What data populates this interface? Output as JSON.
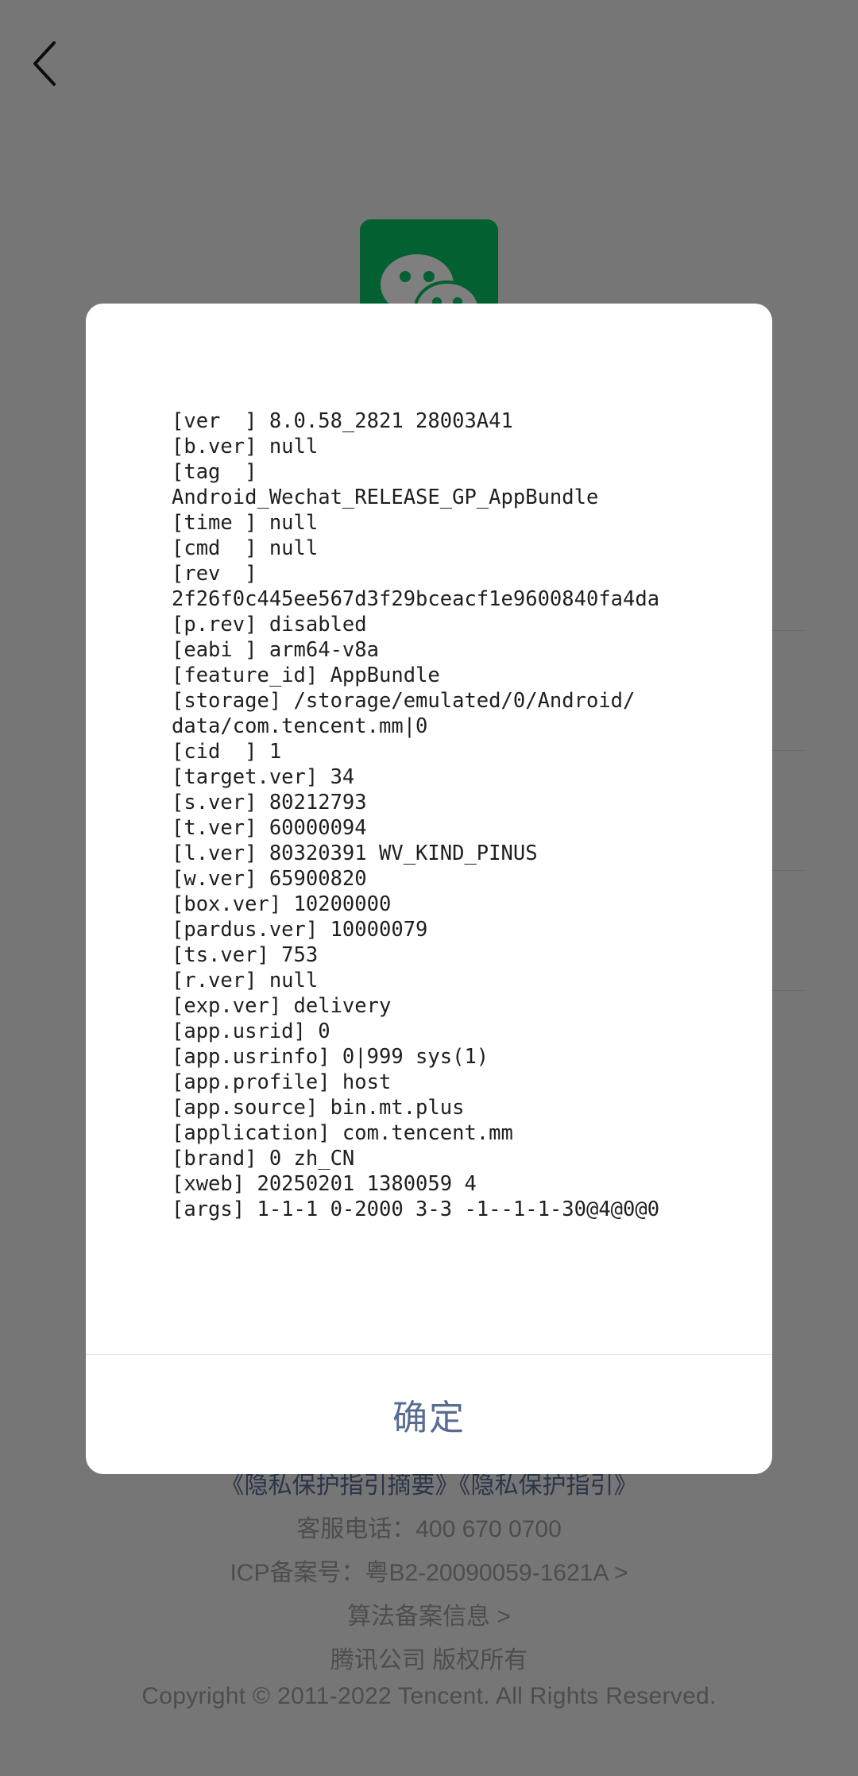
{
  "page": {
    "footer": {
      "privacy_links": "《隐私保护指引摘要》《隐私保护指引》",
      "service_phone": "客服电话：400 670 0700",
      "icp": "ICP备案号：粤B2-20090059-1621A >",
      "algorithm": "算法备案信息 >",
      "company": "腾讯公司 版权所有",
      "copyright": "Copyright © 2011-2022 Tencent. All Rights Reserved."
    }
  },
  "dialog": {
    "lines": [
      "[ver  ] 8.0.58_2821 28003A41",
      "[b.ver] null",
      "[tag  ]",
      "Android_Wechat_RELEASE_GP_AppBundle",
      "[time ] null",
      "[cmd  ] null",
      "[rev  ]",
      "2f26f0c445ee567d3f29bceacf1e9600840fa4da",
      "[p.rev] disabled",
      "[eabi ] arm64-v8a",
      "[feature_id] AppBundle",
      "[storage] /storage/emulated/0/Android/",
      "data/com.tencent.mm|0",
      "[cid  ] 1",
      "[target.ver] 34",
      "[s.ver] 80212793",
      "[t.ver] 60000094",
      "[l.ver] 80320391 WV_KIND_PINUS",
      "[w.ver] 65900820",
      "[box.ver] 10200000",
      "[pardus.ver] 10000079",
      "[ts.ver] 753",
      "[r.ver] null",
      "[exp.ver] delivery",
      "[app.usrid] 0",
      "[app.usrinfo] 0|999 sys(1)",
      "[app.profile] host",
      "[app.source] bin.mt.plus",
      "[application] com.tencent.mm",
      "[brand] 0 zh_CN",
      "[xweb] 20250201 1380059 4",
      "[args] 1-1-1 0-2000 3-3 -1--1-1-30@4@0@0"
    ],
    "confirm_label": "确定"
  },
  "colors": {
    "accent_link": "#576b95",
    "brand_green": "#07c160",
    "mask": "rgba(0,0,0,0.5)"
  },
  "icons": {
    "back": "chevron-left-icon",
    "logo": "wechat-logo-icon"
  }
}
